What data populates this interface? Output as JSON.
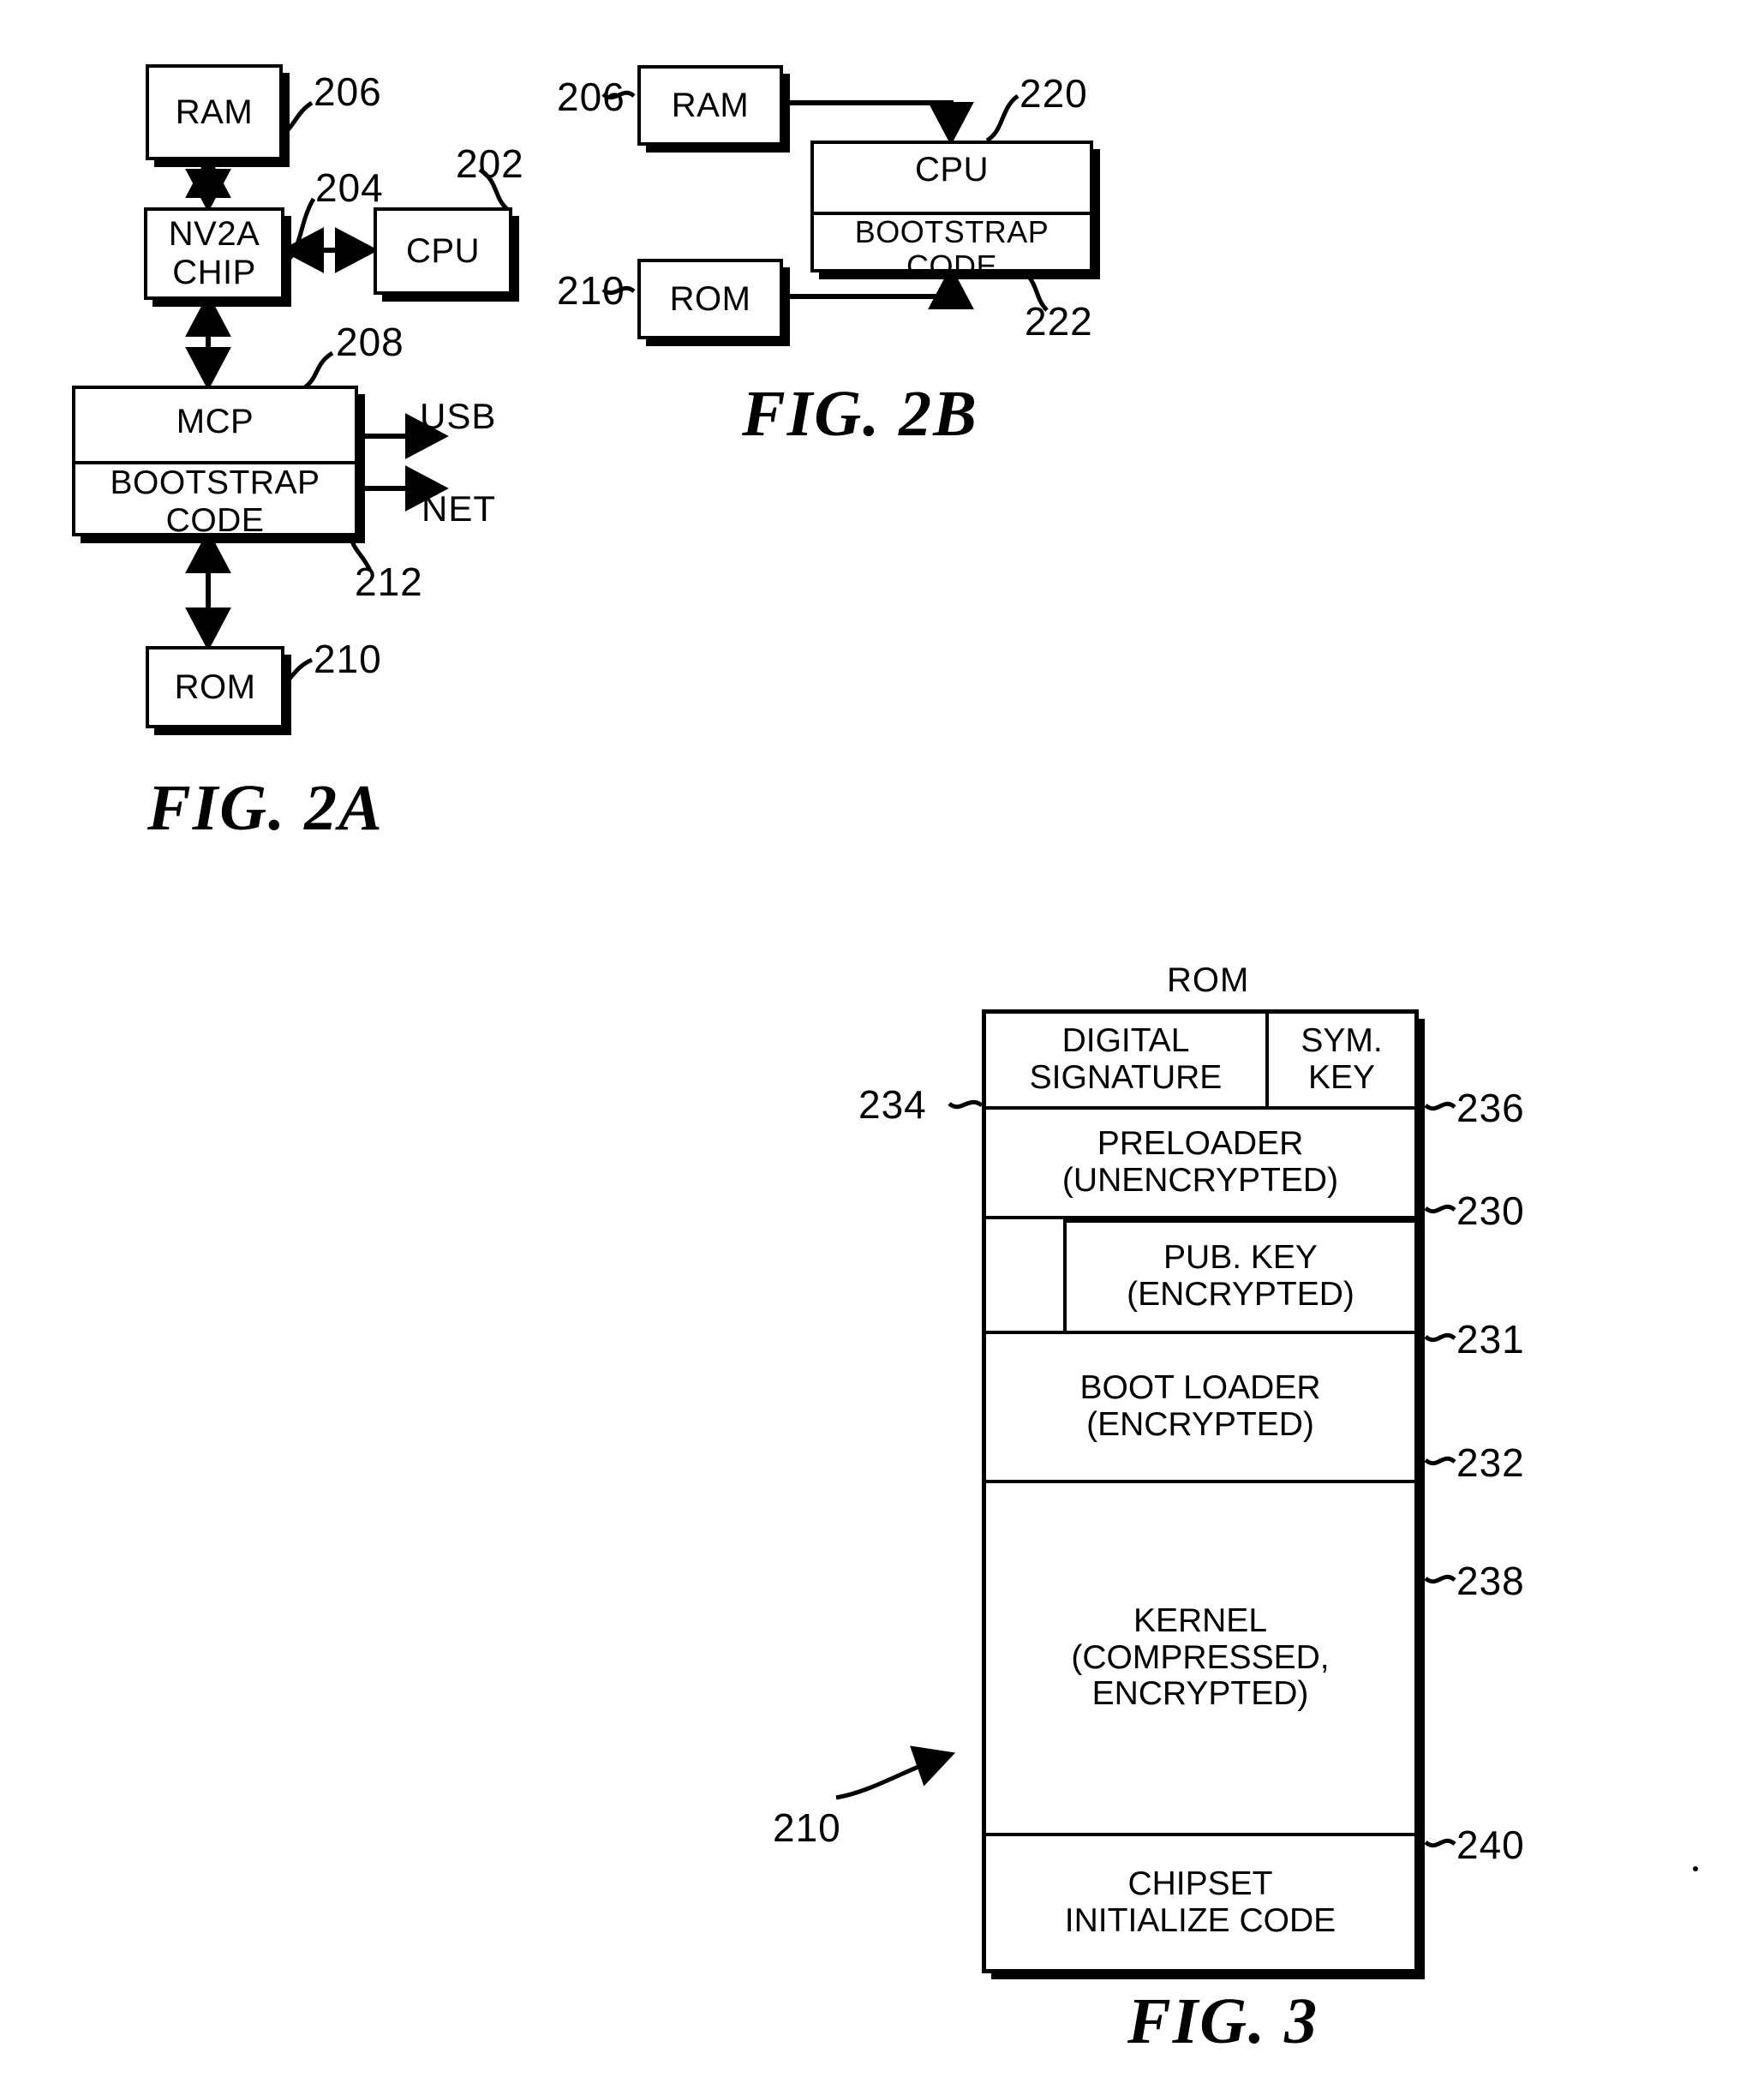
{
  "figures": {
    "fig2a": {
      "caption": "FIG. 2A",
      "blocks": {
        "ram": "RAM",
        "nv2a_line1": "NV2A",
        "nv2a_line2": "CHIP",
        "cpu": "CPU",
        "mcp": "MCP",
        "mcp_bootstrap": "BOOTSTRAP CODE",
        "rom": "ROM"
      },
      "port_labels": {
        "usb": "USB",
        "net": "NET"
      },
      "refs": {
        "ram": "206",
        "nv2a": "204",
        "cpu": "202",
        "mcp": "208",
        "bootstrap": "212",
        "rom": "210"
      }
    },
    "fig2b": {
      "caption": "FIG. 2B",
      "blocks": {
        "ram": "RAM",
        "rom": "ROM",
        "cpu": "CPU",
        "cpu_bootstrap": "BOOTSTRAP CODE"
      },
      "refs": {
        "ram": "206",
        "rom": "210",
        "cpu": "220",
        "bootstrap": "222"
      }
    },
    "fig3": {
      "caption": "FIG. 3",
      "title": "ROM",
      "refs": {
        "digital_signature": "234",
        "sym_key": "236",
        "preloader": "230",
        "pub_key": "231",
        "boot_loader": "232",
        "kernel": "238",
        "chipset": "240",
        "rom_pointer": "210"
      },
      "segments": [
        {
          "kind": "split",
          "left": "DIGITAL\nSIGNATURE",
          "right": "SYM.\nKEY"
        },
        {
          "kind": "full",
          "text": "PRELOADER\n(UNENCRYPTED)"
        },
        {
          "kind": "indented",
          "text": "PUB. KEY\n(ENCRYPTED)"
        },
        {
          "kind": "full",
          "text": "BOOT LOADER\n(ENCRYPTED)"
        },
        {
          "kind": "full",
          "text": "KERNEL\n(COMPRESSED,\nENCRYPTED)"
        },
        {
          "kind": "full",
          "text": "CHIPSET\nINITIALIZE CODE"
        }
      ]
    }
  },
  "colors": {
    "ink": "#000000",
    "paper": "#ffffff"
  }
}
